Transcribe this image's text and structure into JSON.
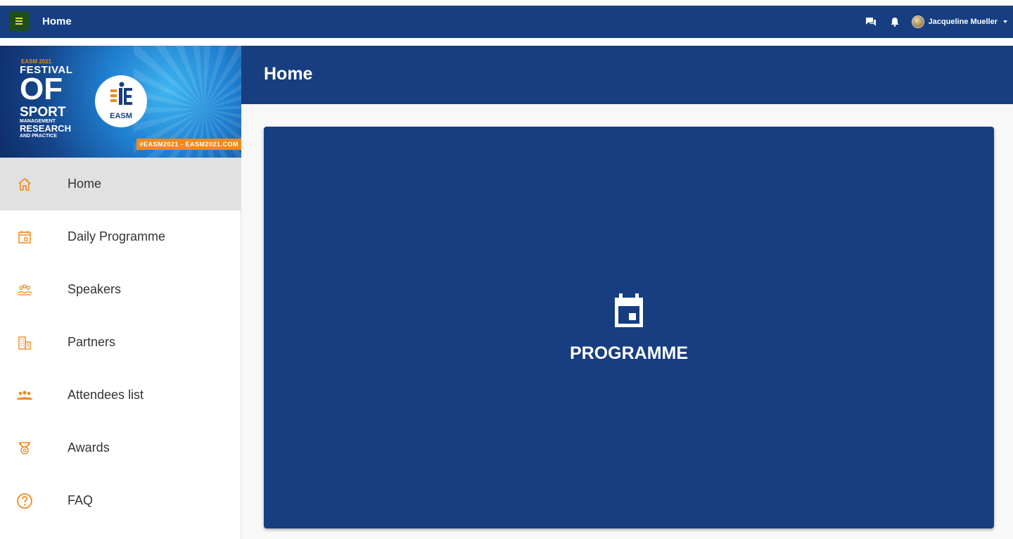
{
  "topbar": {
    "title": "Home",
    "user_name": "Jacqueline Mueller"
  },
  "banner": {
    "year": "EASM 2021",
    "line1": "FESTIVAL",
    "line2": "OF",
    "line3": "SPORT",
    "line4": "MANAGEMENT",
    "line5": "RESEARCH",
    "line6": "AND PRACTICE",
    "logo_text": "EASM",
    "tagline": "#EASM2021 - EASM2021.COM"
  },
  "sidebar": {
    "accent_color": "#f08a1c",
    "items": [
      {
        "label": "Home",
        "icon": "home-icon",
        "active": true
      },
      {
        "label": "Daily Programme",
        "icon": "calendar-icon"
      },
      {
        "label": "Speakers",
        "icon": "speakers-icon"
      },
      {
        "label": "Partners",
        "icon": "buildings-icon"
      },
      {
        "label": "Attendees list",
        "icon": "attendees-icon"
      },
      {
        "label": "Awards",
        "icon": "medal-icon"
      },
      {
        "label": "FAQ",
        "icon": "help-circle-icon"
      }
    ]
  },
  "main": {
    "page_title": "Home",
    "card": {
      "label": "PROGRAMME",
      "icon": "calendar-icon"
    }
  },
  "colors": {
    "brand": "#163e80",
    "accent": "#f08a1c"
  }
}
